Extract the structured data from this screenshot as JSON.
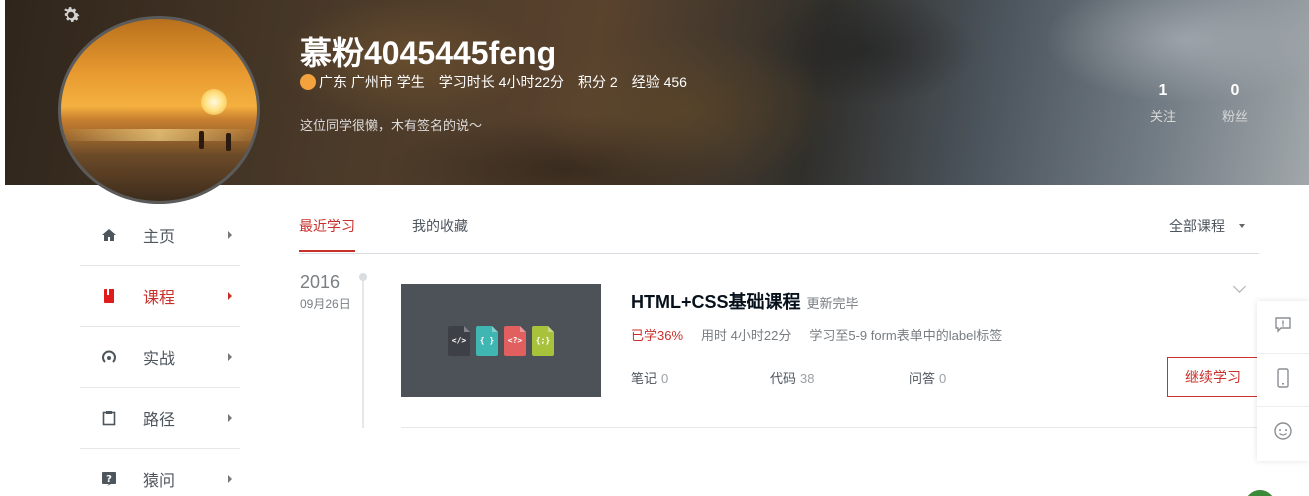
{
  "profile": {
    "username": "慕粉4045445feng",
    "location": "广东 广州市 学生",
    "study_time": "学习时长 4小时22分",
    "points": "积分 2",
    "experience": "经验 456",
    "signature": "这位同学很懒，木有签名的说～",
    "following": {
      "value": "1",
      "label": "关注"
    },
    "followers": {
      "value": "0",
      "label": "粉丝"
    }
  },
  "sidebar": {
    "items": [
      {
        "label": "主页",
        "icon": "home-icon",
        "active": false
      },
      {
        "label": "课程",
        "icon": "book-icon",
        "active": true
      },
      {
        "label": "实战",
        "icon": "signal-icon",
        "active": false
      },
      {
        "label": "路径",
        "icon": "clipboard-icon",
        "active": false
      },
      {
        "label": "猿问",
        "icon": "question-icon",
        "active": false
      }
    ]
  },
  "tabs": {
    "recent": "最近学习",
    "favorites": "我的收藏",
    "filter": "全部课程"
  },
  "timeline": {
    "year": "2016",
    "date": "09月26日"
  },
  "course": {
    "title": "HTML+CSS基础课程",
    "status": "更新完毕",
    "progress": "已学36%",
    "time_used": "用时 4小时22分",
    "current": "学习至5-9 form表单中的label标签",
    "notes_label": "笔记",
    "notes_count": "0",
    "code_label": "代码",
    "code_count": "38",
    "qa_label": "问答",
    "qa_count": "0",
    "continue_label": "继续学习",
    "thumb_icons": [
      "</>",
      "{ }",
      "<?>",
      "{;}"
    ]
  },
  "colors": {
    "accent": "#c9302c",
    "file_colors": [
      "#3d4147",
      "#3fb6b2",
      "#e15f5f",
      "#a8c23c"
    ]
  }
}
